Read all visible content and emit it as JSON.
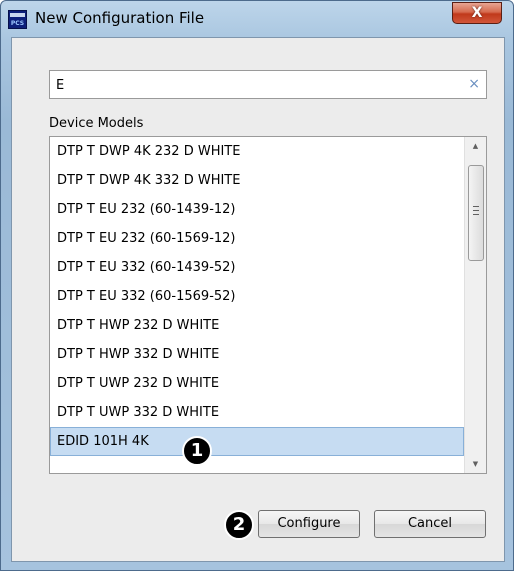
{
  "window": {
    "title": "New Configuration File",
    "icon_name": "pcs-app-icon",
    "icon_text": "PCS",
    "close_glyph": "X"
  },
  "search": {
    "value": "E",
    "clear_glyph": "×"
  },
  "device_list": {
    "label": "Device Models",
    "items": [
      "DTP T DWP 4K 232 D WHITE",
      "DTP T DWP 4K 332 D WHITE",
      "DTP T EU 232 (60-1439-12)",
      "DTP T EU 232 (60-1569-12)",
      "DTP T EU 332 (60-1439-52)",
      "DTP T EU 332 (60-1569-52)",
      "DTP T HWP 232 D WHITE",
      "DTP T HWP 332 D WHITE",
      "DTP T UWP 232 D WHITE",
      "DTP T UWP 332 D WHITE",
      "EDID 101H 4K"
    ],
    "selected_index": 10,
    "selected_color": "#c6dcf2"
  },
  "callouts": {
    "one": "1",
    "two": "2"
  },
  "buttons": {
    "configure": "Configure",
    "cancel": "Cancel"
  }
}
